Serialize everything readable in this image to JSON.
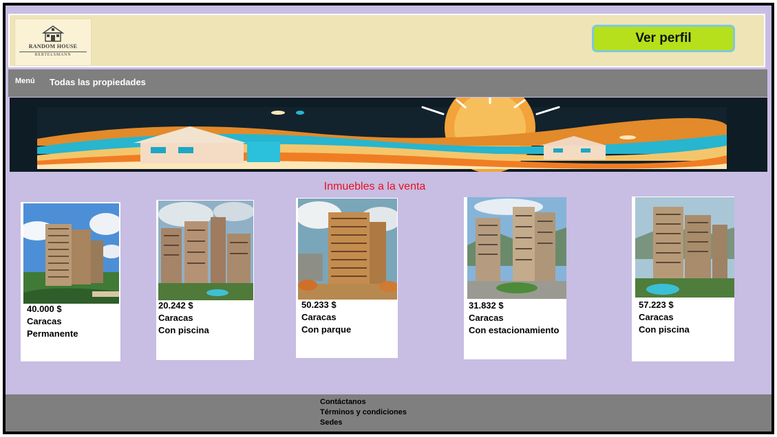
{
  "logo": {
    "line1": "RANDOM HOUSE",
    "line2": "BERTELSMANN"
  },
  "header": {
    "profile_button": "Ver perfil"
  },
  "nav": {
    "menu": "Menú",
    "all_properties": "Todas las propiedades"
  },
  "section": {
    "title": "Inmuebles a la venta"
  },
  "listings": [
    {
      "price": "40.000 $",
      "city": "Caracas",
      "feature": "Permanente"
    },
    {
      "price": "20.242 $",
      "city": "Caracas",
      "feature": "Con piscina"
    },
    {
      "price": "50.233 $",
      "city": "Caracas",
      "feature": "Con parque"
    },
    {
      "price": "31.832 $",
      "city": "Caracas",
      "feature": "Con estacionamiento"
    },
    {
      "price": "57.223 $",
      "city": "Caracas",
      "feature": "Con piscina"
    }
  ],
  "footer": {
    "contact": "Contáctanos",
    "terms": "Términos y condiciones",
    "locations": "Sedes"
  },
  "colors": {
    "page_bg": "#c8bde3",
    "header_bg": "#efe4b5",
    "nav_bg": "#7f7f7f",
    "profile_button": "#b5e01b",
    "title": "#e8101e"
  }
}
